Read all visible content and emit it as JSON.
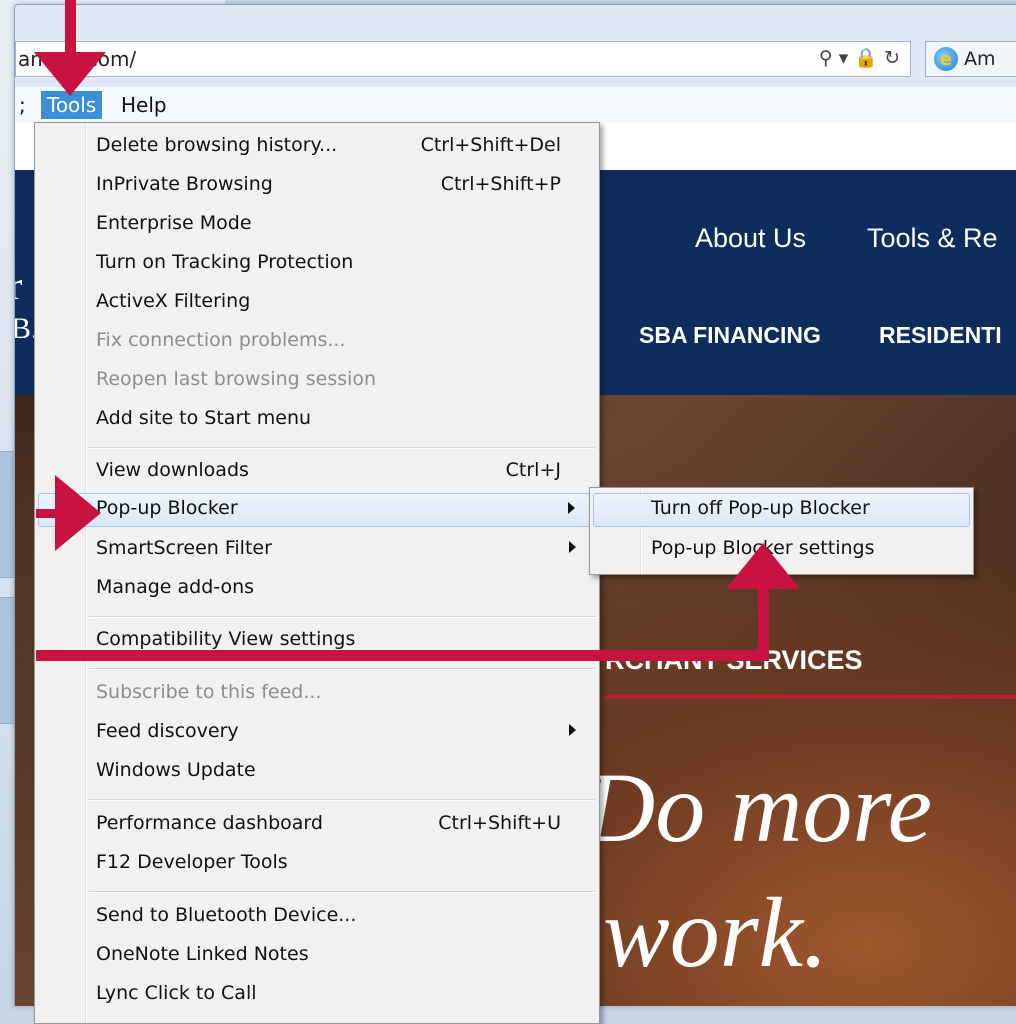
{
  "browser": {
    "address": "am      nk.com/",
    "address_icons": "⚲ ▾ 🔒 ↻",
    "tab_label": "Am"
  },
  "menubar": {
    "left_fragment": ";",
    "tools": "Tools",
    "help": "Help"
  },
  "site": {
    "nav_about": "About Us",
    "nav_tools": "Tools & Re",
    "nav_sba": "SBA FINANCING",
    "nav_residential": "RESIDENTI",
    "logo_a": "r",
    "logo_b": "B.",
    "merchant": "RCHANT SERVICES",
    "hero_line1": "Do more",
    "hero_line2": "work."
  },
  "tools_menu": {
    "items": [
      {
        "label": "Delete browsing history...",
        "shortcut": "Ctrl+Shift+Del"
      },
      {
        "label": "InPrivate Browsing",
        "shortcut": "Ctrl+Shift+P"
      },
      {
        "label": "Enterprise Mode",
        "shortcut": ""
      },
      {
        "label": "Turn on Tracking Protection",
        "shortcut": ""
      },
      {
        "label": "ActiveX Filtering",
        "shortcut": ""
      },
      {
        "label": "Fix connection problems...",
        "shortcut": ""
      },
      {
        "label": "Reopen last browsing session",
        "shortcut": ""
      },
      {
        "label": "Add site to Start menu",
        "shortcut": ""
      },
      {
        "label": "View downloads",
        "shortcut": "Ctrl+J"
      },
      {
        "label": "Pop-up Blocker",
        "shortcut": ""
      },
      {
        "label": "SmartScreen Filter",
        "shortcut": ""
      },
      {
        "label": "Manage add-ons",
        "shortcut": ""
      },
      {
        "label": "Compatibility View settings",
        "shortcut": ""
      },
      {
        "label": "Subscribe to this feed...",
        "shortcut": ""
      },
      {
        "label": "Feed discovery",
        "shortcut": ""
      },
      {
        "label": "Windows Update",
        "shortcut": ""
      },
      {
        "label": "Performance dashboard",
        "shortcut": "Ctrl+Shift+U"
      },
      {
        "label": "F12 Developer Tools",
        "shortcut": ""
      },
      {
        "label": "Send to Bluetooth Device...",
        "shortcut": ""
      },
      {
        "label": "OneNote Linked Notes",
        "shortcut": ""
      },
      {
        "label": "Lync Click to Call",
        "shortcut": ""
      }
    ]
  },
  "popup_submenu": {
    "items": [
      {
        "label": "Turn off Pop-up Blocker"
      },
      {
        "label": "Pop-up Blocker settings"
      }
    ]
  },
  "colors": {
    "annotation_red": "#c8123f",
    "site_navy": "#0f2d5c",
    "menu_highlight": "#dbe7f8"
  }
}
